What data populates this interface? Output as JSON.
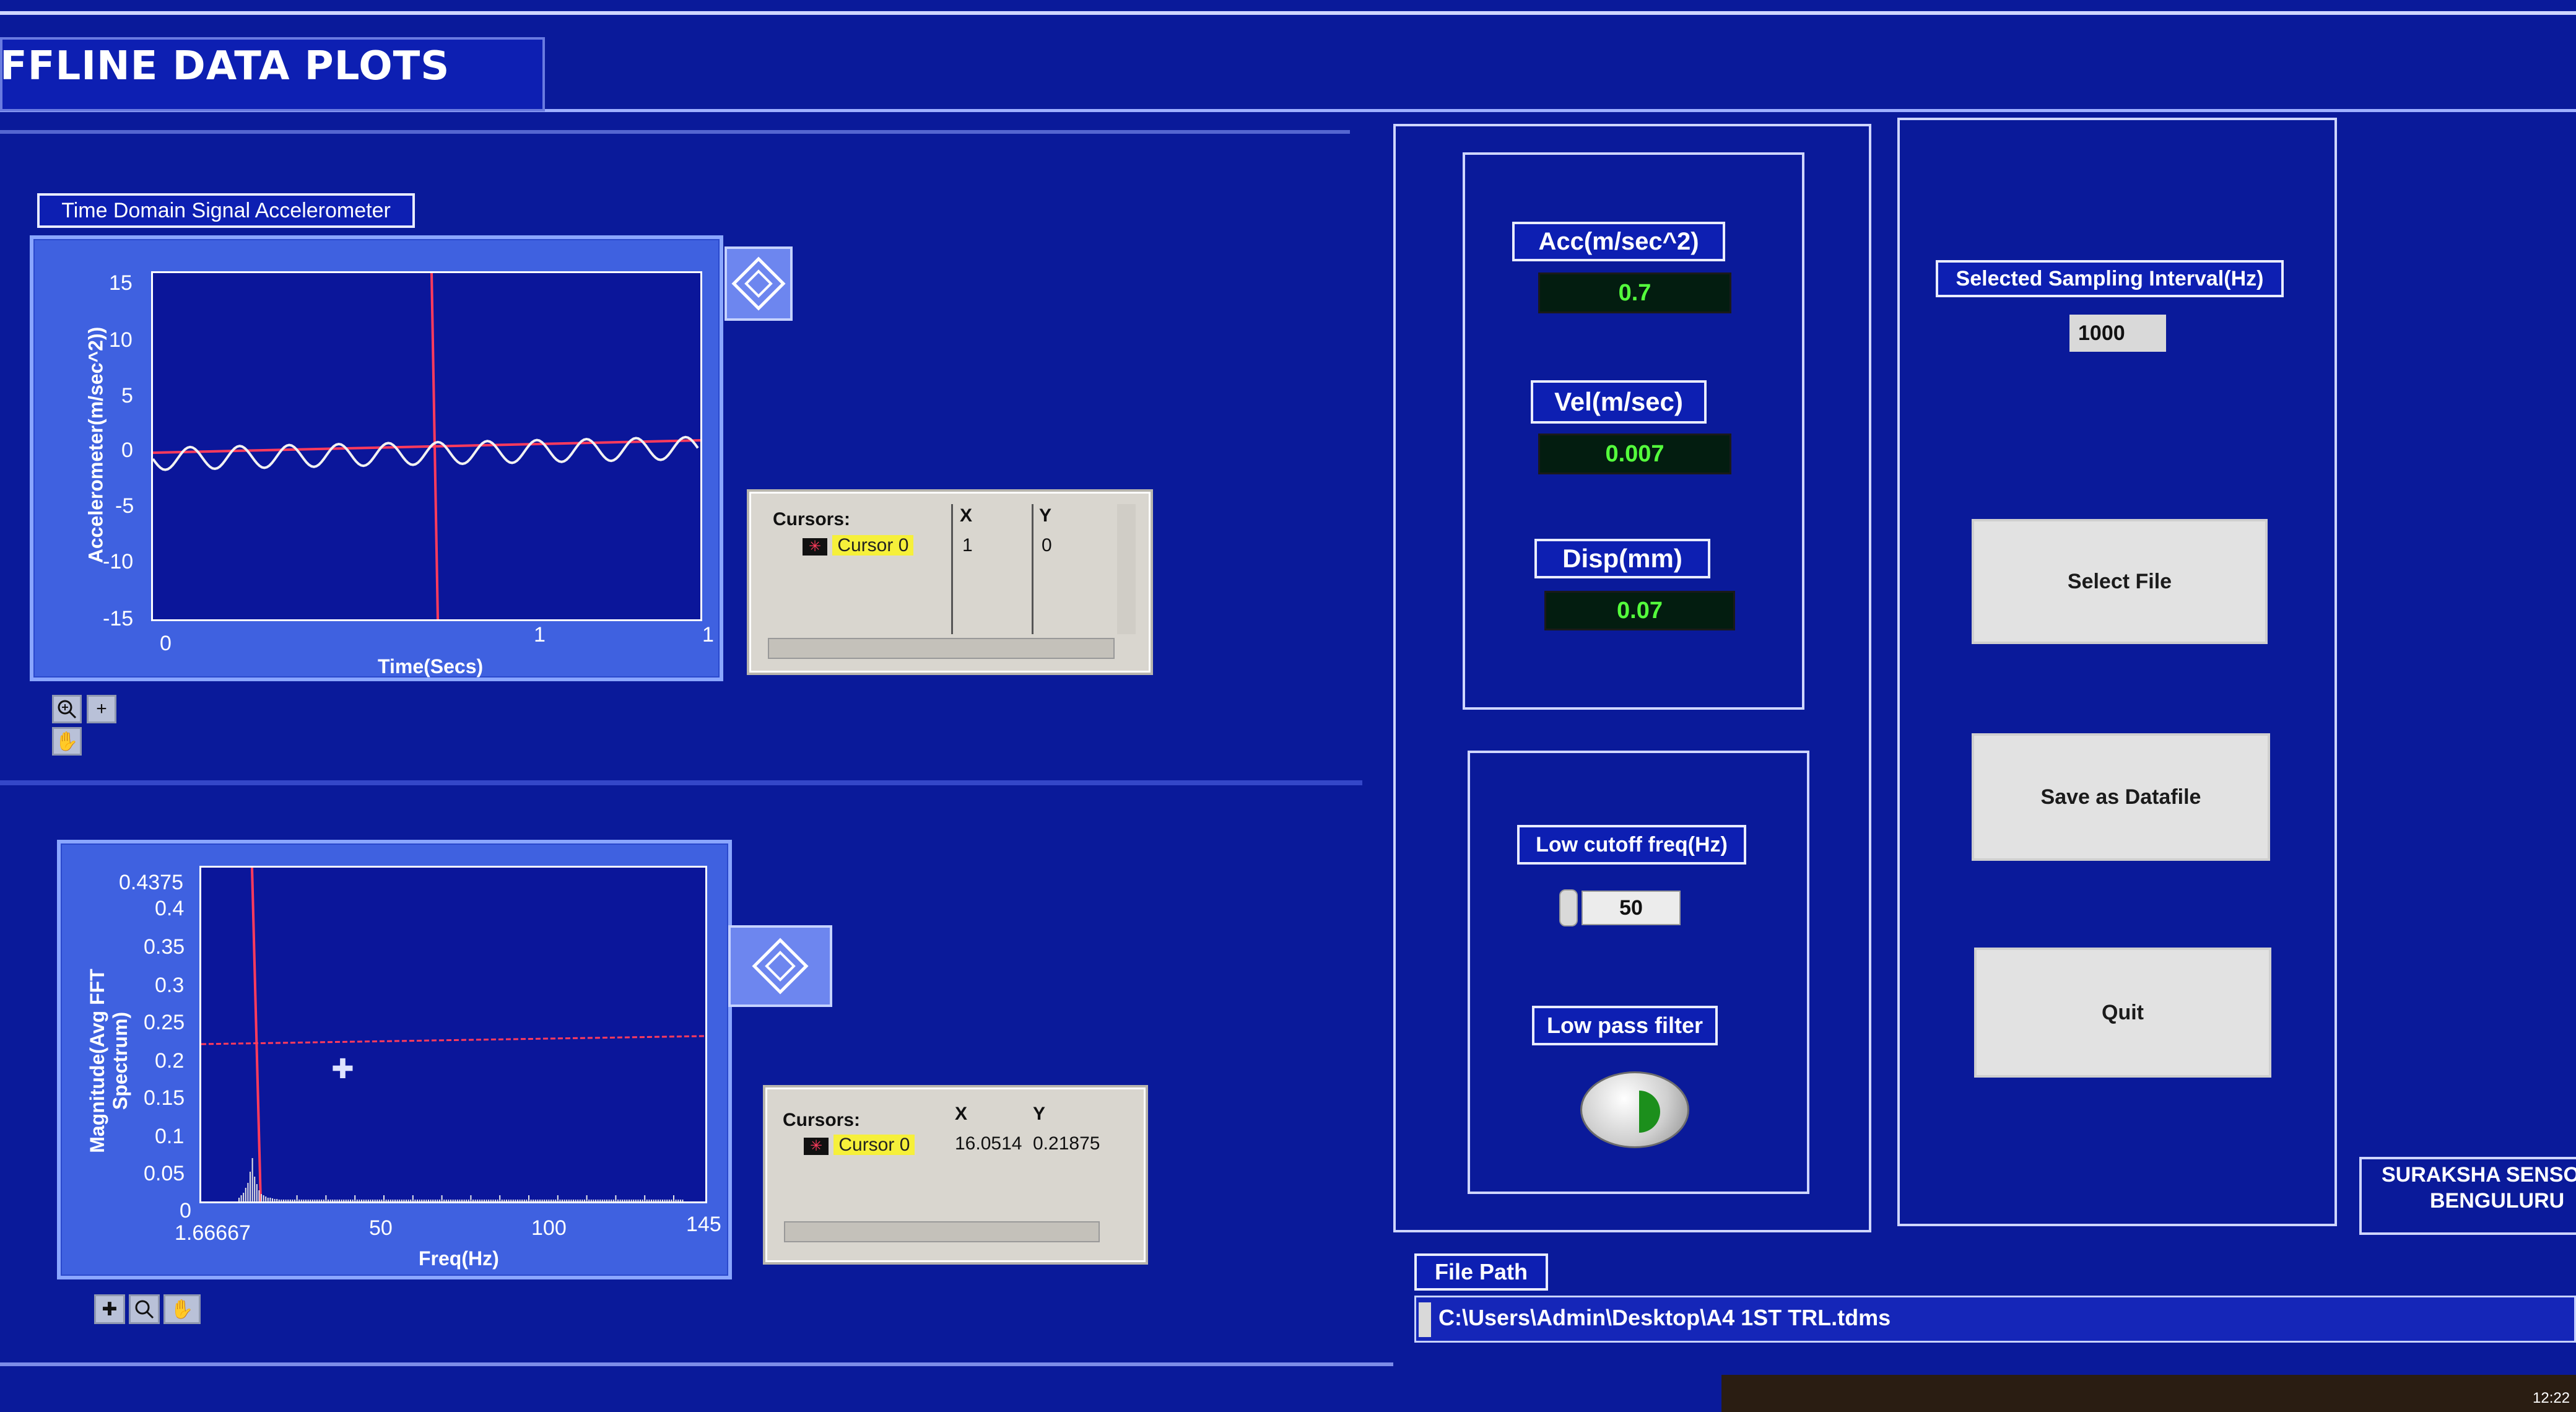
{
  "window": {
    "title": "FFLINE DATA PLOTS"
  },
  "time_plot": {
    "title": "Time Domain Signal  Accelerometer",
    "ylabel": "Accelerometer(m/sec^2))",
    "xlabel": "Time(Secs)",
    "yticks": [
      "15",
      "10",
      "5",
      "0",
      "-5",
      "-10",
      "-15"
    ],
    "xticks": [
      "0",
      "1",
      "1"
    ],
    "cursors": {
      "header": "Cursors:",
      "col_x": "X",
      "col_y": "Y",
      "cursor_name": "Cursor 0",
      "x": "1",
      "y": "0"
    }
  },
  "fft_plot": {
    "ylabel": "Magnitude(Avg FFT Spectrum)",
    "xlabel": "Freq(Hz)",
    "yticks": [
      "0.4375",
      "0.4",
      "0.35",
      "0.3",
      "0.25",
      "0.2",
      "0.15",
      "0.1",
      "0.05",
      "0"
    ],
    "xticks": [
      "1.66667",
      "50",
      "100",
      "145"
    ],
    "cursors": {
      "header": "Cursors:",
      "col_x": "X",
      "col_y": "Y",
      "cursor_name": "Cursor 0",
      "x": "16.0514",
      "y": "0.21875"
    }
  },
  "metrics": {
    "acc_label": "Acc(m/sec^2)",
    "acc_value": "0.7",
    "vel_label": "Vel(m/sec)",
    "vel_value": "0.007",
    "disp_label": "Disp(mm)",
    "disp_value": "0.07"
  },
  "filter": {
    "cutoff_label": "Low cutoff freq(Hz)",
    "cutoff_value": "50",
    "lowpass_label": "Low pass filter"
  },
  "controls": {
    "sampling_label": "Selected Sampling Interval(Hz)",
    "sampling_value": "1000",
    "select_file": "Select File",
    "save_datafile": "Save as Datafile",
    "quit": "Quit"
  },
  "company": {
    "line1": "SURAKSHA SENSO",
    "line2": "BENGULURU"
  },
  "file": {
    "label": "File Path",
    "path": "C:\\Users\\Admin\\Desktop\\A4 1ST TRL.tdms"
  },
  "taskbar": {
    "clock": "12:22"
  },
  "colors": {
    "background": "#0a1a9a",
    "plot_background": "#0b169a",
    "cursor_line": "#ff3b5c",
    "indicator_text": "#54ff3c",
    "cursor_tag": "#f6f03a"
  }
}
